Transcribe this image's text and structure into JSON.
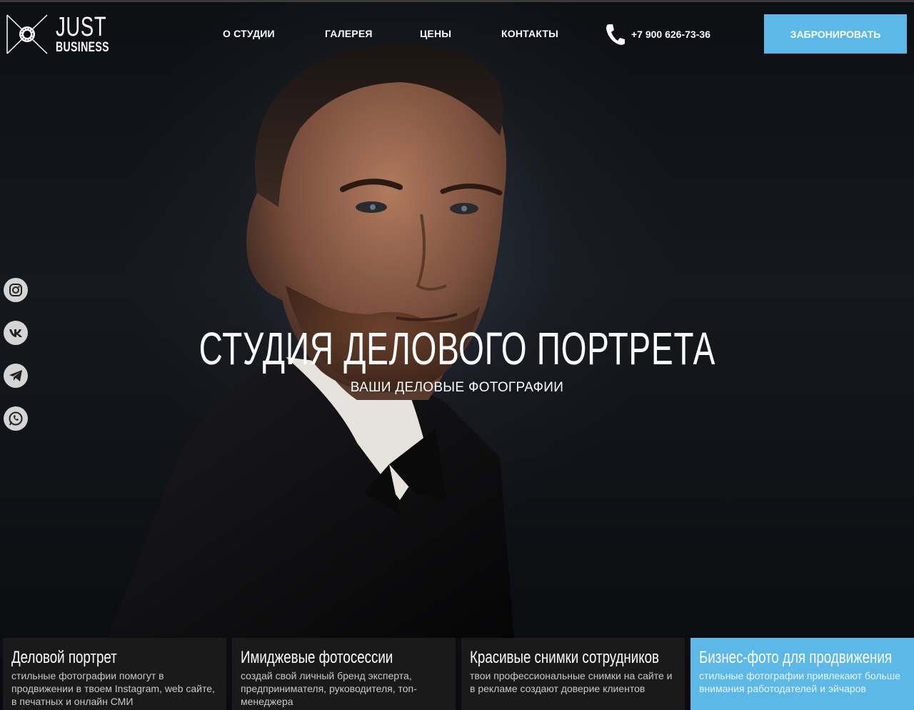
{
  "logo": {
    "line1": "JUST",
    "line2": "BUSINESS"
  },
  "nav": [
    {
      "label": "О СТУДИИ"
    },
    {
      "label": "ГАЛЕРЕЯ"
    },
    {
      "label": "ЦЕНЫ"
    },
    {
      "label": "КОНТАКТЫ"
    }
  ],
  "phone": {
    "icon": "phone-icon",
    "number": "+7 900 626-73-36"
  },
  "book_button": {
    "label": "ЗАБРОНИРОВАТЬ",
    "color": "#5cb8e6"
  },
  "social": [
    {
      "icon": "instagram-icon"
    },
    {
      "icon": "vk-icon"
    },
    {
      "icon": "telegram-icon"
    },
    {
      "icon": "whatsapp-icon"
    }
  ],
  "hero": {
    "title": "СТУДИЯ ДЕЛОВОГО ПОРТРЕТА",
    "subtitle": "ВАШИ ДЕЛОВЫЕ ФОТОГРАФИИ"
  },
  "cards": [
    {
      "title": "Деловой портрет",
      "text": "стильные фотографии помогут в продвижении в твоем Instagram, web сайте, в печатных и онлайн СМИ"
    },
    {
      "title": "Имиджевые фотосессии",
      "text": "создай свой личный бренд эксперта, предпринимателя, руководителя, топ-менеджера"
    },
    {
      "title": "Красивые снимки сотрудников",
      "text": "твои профессиональные снимки на сайте и в рекламе создают доверие клиентов"
    },
    {
      "title": "Бизнес-фото для продвижения",
      "text": "стильные фотографии привлекают больше внимания работодателей и эйчаров"
    }
  ],
  "colors": {
    "accent": "#5cb8e6",
    "card_bg": "#1a1a1a"
  }
}
